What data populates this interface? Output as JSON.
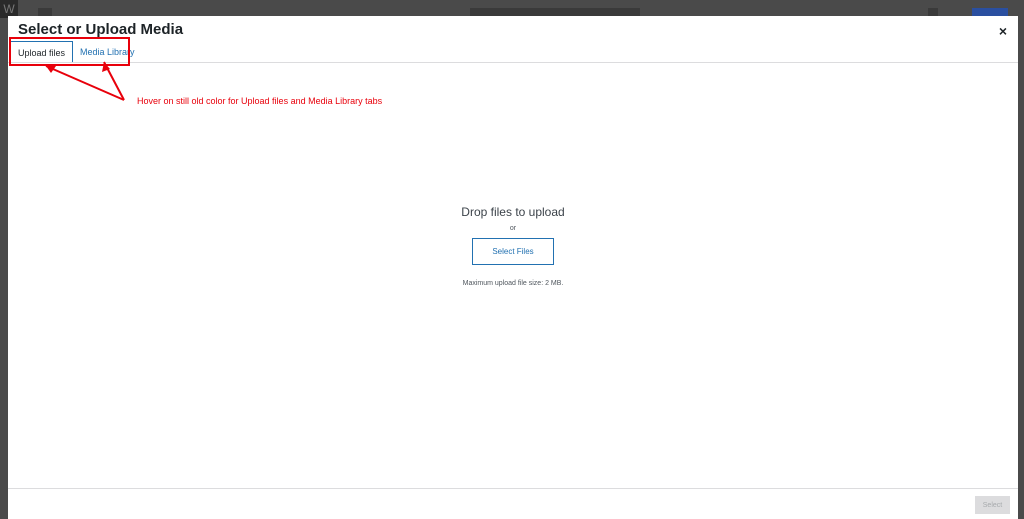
{
  "modal": {
    "title": "Select or Upload Media",
    "close_glyph": "×"
  },
  "tabs": [
    {
      "label": "Upload files",
      "active": true
    },
    {
      "label": "Media Library",
      "active": false
    }
  ],
  "uploader": {
    "drop_title": "Drop files to upload",
    "or_text": "or",
    "select_files_label": "Select Files",
    "max_size_text": "Maximum upload file size: 2 MB."
  },
  "footer": {
    "select_label": "Select"
  },
  "annotation": {
    "text": "Hover on still old color for Upload files and Media Library tabs",
    "color": "#e8000b"
  },
  "colors": {
    "accent": "#2271b1",
    "backdrop": "#4a4a4a"
  }
}
